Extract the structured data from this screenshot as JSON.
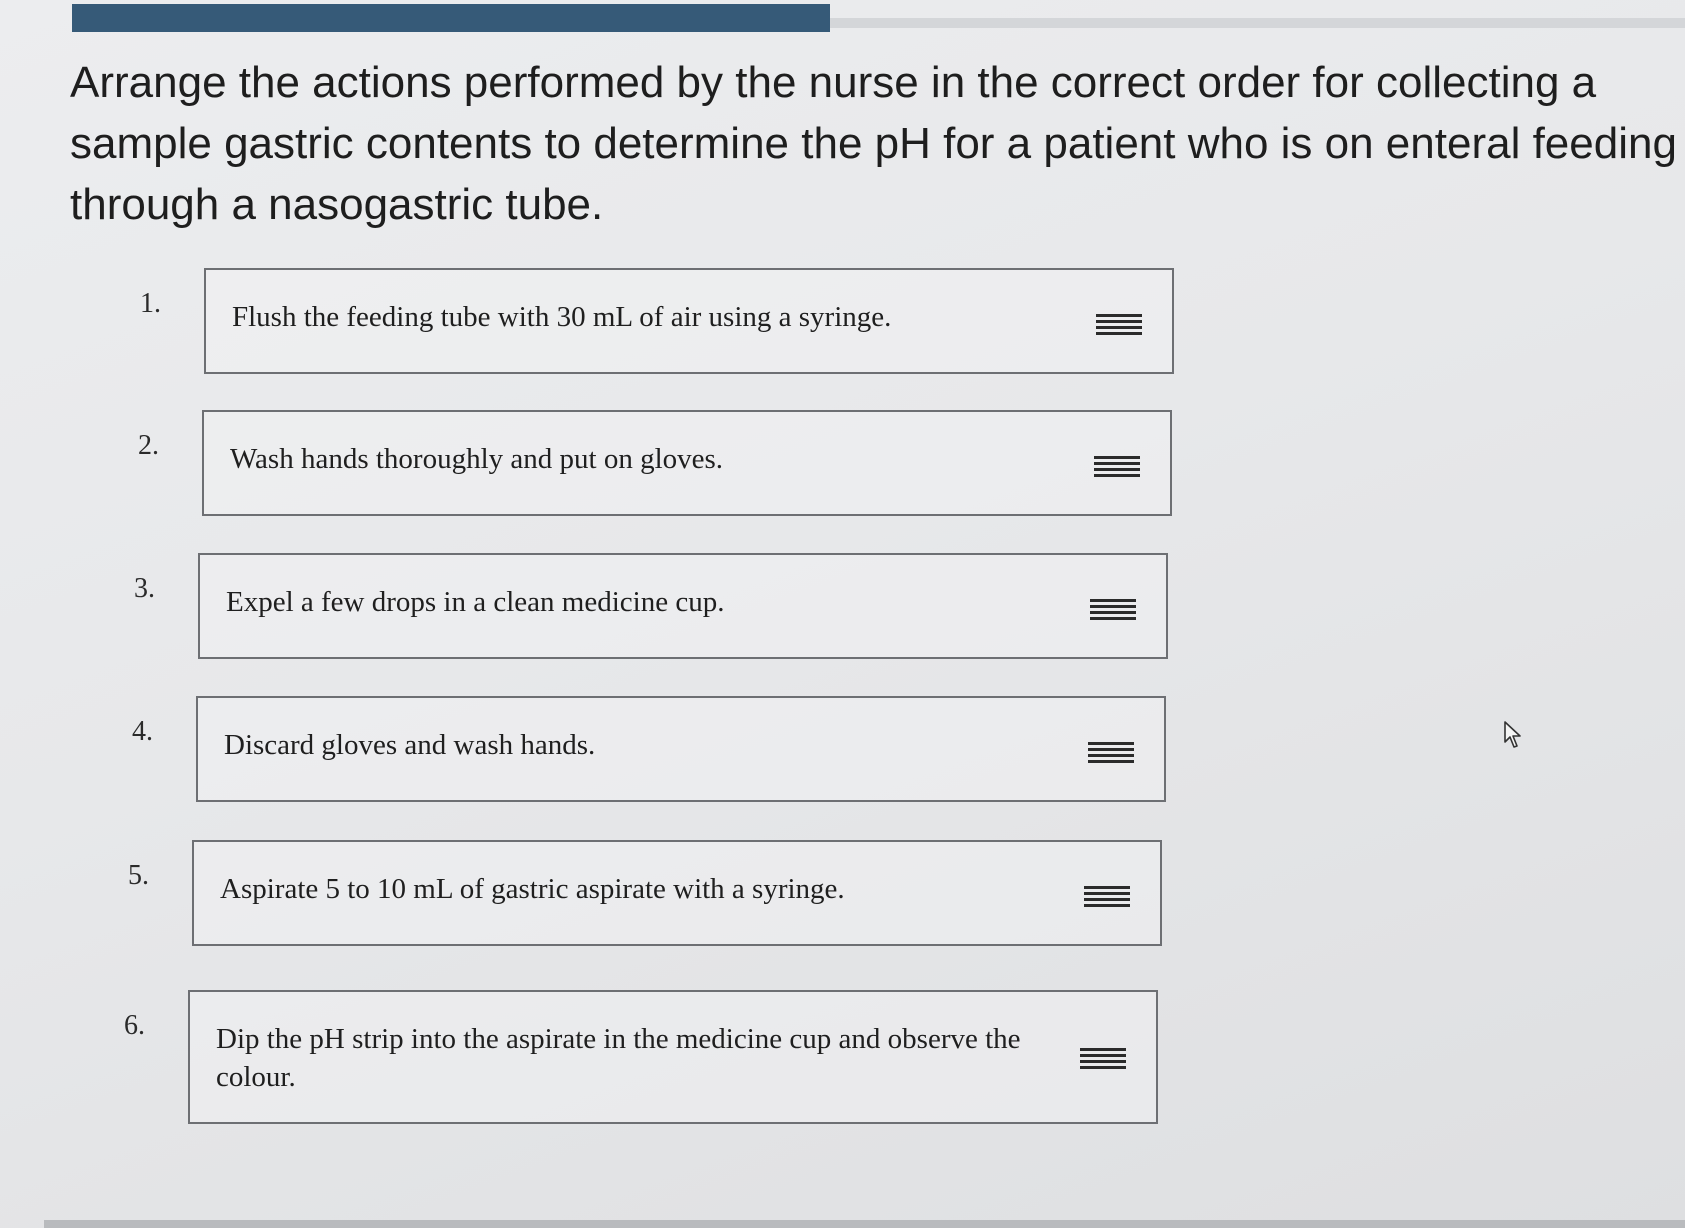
{
  "progress": {
    "fraction": 0.47
  },
  "question": {
    "text": "Arrange the actions performed by the nurse in the correct order for collecting a sample gastric contents to determine the pH for a patient who is on enteral feeding through a nasogastric tube."
  },
  "items": [
    {
      "number": "1.",
      "text": "Flush the feeding tube with 30 mL of air using a syringe.",
      "handle_icon": "drag-handle-icon"
    },
    {
      "number": "2.",
      "text": "Wash hands thoroughly and put on gloves.",
      "handle_icon": "drag-handle-icon"
    },
    {
      "number": "3.",
      "text": "Expel a few drops in a clean medicine cup.",
      "handle_icon": "drag-handle-icon"
    },
    {
      "number": "4.",
      "text": "Discard gloves and wash hands.",
      "handle_icon": "drag-handle-icon"
    },
    {
      "number": "5.",
      "text": "Aspirate 5 to 10 mL of gastric aspirate with a syringe.",
      "handle_icon": "drag-handle-icon"
    },
    {
      "number": "6.",
      "text": "Dip the pH strip into the aspirate in the medicine cup and observe the colour.",
      "handle_icon": "drag-handle-icon"
    }
  ],
  "colors": {
    "progress_fill": "#365a78",
    "card_border": "#6d6f73",
    "background": "#e8e9eb"
  }
}
